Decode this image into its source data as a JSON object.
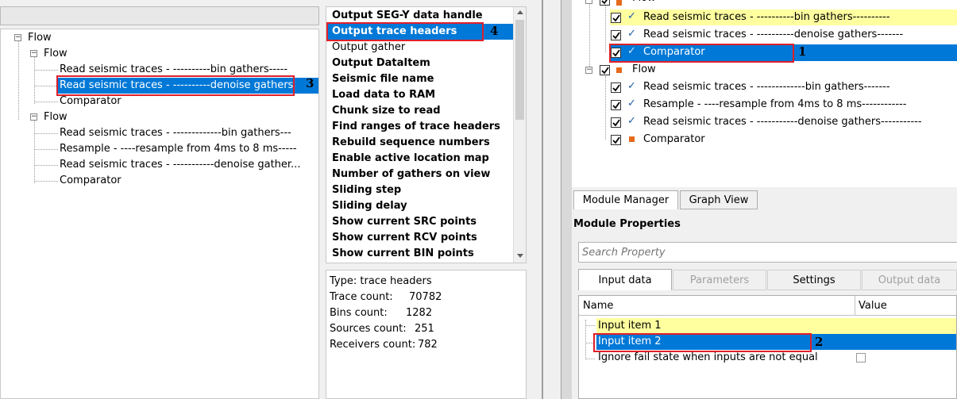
{
  "left_tree": {
    "items": [
      {
        "label": "Flow",
        "level": 0
      },
      {
        "label": "Flow",
        "level": 1
      },
      {
        "label": "Read seismic traces - ----------bin gathers-----",
        "level": 2
      },
      {
        "label": "Read seismic traces - ----------denoise gathers",
        "level": 2
      },
      {
        "label": "Comparator",
        "level": 2
      },
      {
        "label": "Flow",
        "level": 1
      },
      {
        "label": "Read seismic traces - -------------bin gathers---",
        "level": 2
      },
      {
        "label": "Resample - ----resample from 4ms to 8 ms-----",
        "level": 2
      },
      {
        "label": "Read seismic traces - -----------denoise gather...",
        "level": 2
      },
      {
        "label": "Comparator",
        "level": 2
      }
    ],
    "marker": "3"
  },
  "handle_list": {
    "items": [
      {
        "label": "Output SEG-Y data handle",
        "bold": true
      },
      {
        "label": "Output trace headers",
        "bold": true
      },
      {
        "label": "Output gather",
        "bold": false
      },
      {
        "label": "Output DataItem",
        "bold": true
      },
      {
        "label": "Seismic file name",
        "bold": true
      },
      {
        "label": "Load data to RAM",
        "bold": true
      },
      {
        "label": "Chunk size to read",
        "bold": true
      },
      {
        "label": "Find ranges of trace headers",
        "bold": true
      },
      {
        "label": "Rebuild sequence numbers",
        "bold": true
      },
      {
        "label": "Enable active location map",
        "bold": true
      },
      {
        "label": "Number of gathers on view",
        "bold": true
      },
      {
        "label": "Sliding step",
        "bold": true
      },
      {
        "label": "Sliding delay",
        "bold": true
      },
      {
        "label": "Show current SRC points",
        "bold": true
      },
      {
        "label": "Show current RCV points",
        "bold": true
      },
      {
        "label": "Show current BIN points",
        "bold": true
      }
    ],
    "marker": "4"
  },
  "info": {
    "type_line": "Type: trace headers",
    "trace_label": "Trace count:",
    "trace_value": "70782",
    "bins_label": "Bins count:",
    "bins_value": "1282",
    "sources_label": "Sources count:",
    "sources_value": "251",
    "receivers_label": "Receivers count:",
    "receivers_value": "782"
  },
  "right_tree": {
    "items": [
      {
        "label": "Flow",
        "kind": "flow"
      },
      {
        "label": "Read seismic traces - ----------bin gathers----------",
        "kind": "tick"
      },
      {
        "label": "Read seismic traces - ----------denoise gathers-------",
        "kind": "tick"
      },
      {
        "label": "Comparator",
        "kind": "tick"
      },
      {
        "label": "Flow",
        "kind": "flow"
      },
      {
        "label": "Read seismic traces - -------------bin gathers-------",
        "kind": "tick"
      },
      {
        "label": "Resample - ----resample from 4ms to 8 ms------------",
        "kind": "tick"
      },
      {
        "label": "Read seismic traces - -----------denoise gathers-----------",
        "kind": "tick"
      },
      {
        "label": "Comparator",
        "kind": "square"
      }
    ],
    "marker": "1"
  },
  "tabs": {
    "module_manager": "Module Manager",
    "graph_view": "Graph View"
  },
  "module_properties": {
    "title": "Module Properties",
    "search_placeholder": "Search Property",
    "tabs": [
      "Input data",
      "Parameters",
      "Settings",
      "Output data"
    ],
    "col_name": "Name",
    "col_value": "Value",
    "rows": [
      "Input item 1",
      "Input item 2",
      "Ignore fail state when inputs are not equal"
    ],
    "marker": "2"
  },
  "colors": {
    "selection": "#0078d7",
    "highlight": "#ffffa0",
    "annotation": "#e0202a"
  }
}
